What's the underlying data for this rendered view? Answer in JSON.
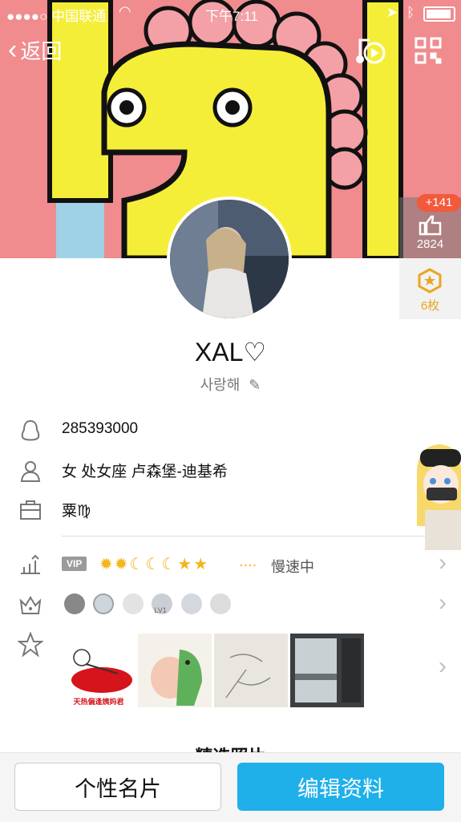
{
  "status": {
    "carrier": "●●●●○ 中国联通",
    "time": "下午7:11"
  },
  "nav": {
    "back_label": "返回"
  },
  "like": {
    "increment": "+141",
    "count": "2824"
  },
  "medal": {
    "count_label": "6枚"
  },
  "profile": {
    "nickname": "XAL♡",
    "signature": "사랑해",
    "qq_number": "285393000",
    "info": "女  处女座  卢森堡-迪基希",
    "location_label": "粟♍"
  },
  "vip": {
    "tag": "VIP",
    "status": "慢速中",
    "dots": "...."
  },
  "badges": {
    "lv_label": "LV1"
  },
  "section_title": "精选照片",
  "photos": {
    "first_caption": "天热偏逢姨妈君"
  },
  "buttons": {
    "card": "个性名片",
    "edit": "编辑资料"
  },
  "colors": {
    "banner": "#f08b8e",
    "primary": "#1fb0ea",
    "medal": "#e9a622"
  }
}
